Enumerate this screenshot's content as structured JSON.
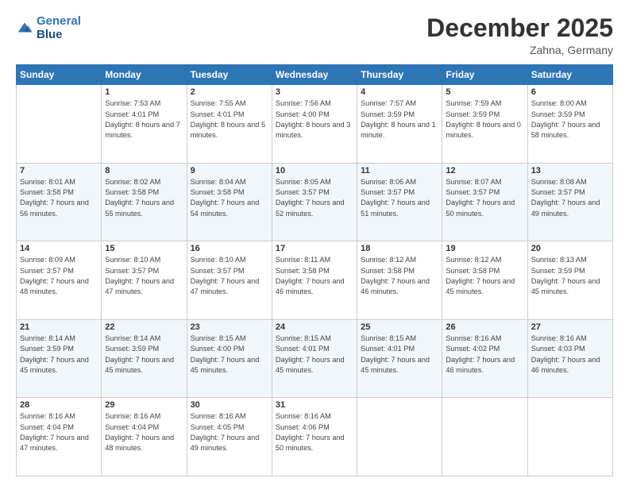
{
  "header": {
    "logo_line1": "General",
    "logo_line2": "Blue",
    "month": "December 2025",
    "location": "Zahna, Germany"
  },
  "days_of_week": [
    "Sunday",
    "Monday",
    "Tuesday",
    "Wednesday",
    "Thursday",
    "Friday",
    "Saturday"
  ],
  "weeks": [
    [
      {
        "day": "",
        "sunrise": "",
        "sunset": "",
        "daylight": ""
      },
      {
        "day": "1",
        "sunrise": "Sunrise: 7:53 AM",
        "sunset": "Sunset: 4:01 PM",
        "daylight": "Daylight: 8 hours and 7 minutes."
      },
      {
        "day": "2",
        "sunrise": "Sunrise: 7:55 AM",
        "sunset": "Sunset: 4:01 PM",
        "daylight": "Daylight: 8 hours and 5 minutes."
      },
      {
        "day": "3",
        "sunrise": "Sunrise: 7:56 AM",
        "sunset": "Sunset: 4:00 PM",
        "daylight": "Daylight: 8 hours and 3 minutes."
      },
      {
        "day": "4",
        "sunrise": "Sunrise: 7:57 AM",
        "sunset": "Sunset: 3:59 PM",
        "daylight": "Daylight: 8 hours and 1 minute."
      },
      {
        "day": "5",
        "sunrise": "Sunrise: 7:59 AM",
        "sunset": "Sunset: 3:59 PM",
        "daylight": "Daylight: 8 hours and 0 minutes."
      },
      {
        "day": "6",
        "sunrise": "Sunrise: 8:00 AM",
        "sunset": "Sunset: 3:59 PM",
        "daylight": "Daylight: 7 hours and 58 minutes."
      }
    ],
    [
      {
        "day": "7",
        "sunrise": "Sunrise: 8:01 AM",
        "sunset": "Sunset: 3:58 PM",
        "daylight": "Daylight: 7 hours and 56 minutes."
      },
      {
        "day": "8",
        "sunrise": "Sunrise: 8:02 AM",
        "sunset": "Sunset: 3:58 PM",
        "daylight": "Daylight: 7 hours and 55 minutes."
      },
      {
        "day": "9",
        "sunrise": "Sunrise: 8:04 AM",
        "sunset": "Sunset: 3:58 PM",
        "daylight": "Daylight: 7 hours and 54 minutes."
      },
      {
        "day": "10",
        "sunrise": "Sunrise: 8:05 AM",
        "sunset": "Sunset: 3:57 PM",
        "daylight": "Daylight: 7 hours and 52 minutes."
      },
      {
        "day": "11",
        "sunrise": "Sunrise: 8:06 AM",
        "sunset": "Sunset: 3:57 PM",
        "daylight": "Daylight: 7 hours and 51 minutes."
      },
      {
        "day": "12",
        "sunrise": "Sunrise: 8:07 AM",
        "sunset": "Sunset: 3:57 PM",
        "daylight": "Daylight: 7 hours and 50 minutes."
      },
      {
        "day": "13",
        "sunrise": "Sunrise: 8:08 AM",
        "sunset": "Sunset: 3:57 PM",
        "daylight": "Daylight: 7 hours and 49 minutes."
      }
    ],
    [
      {
        "day": "14",
        "sunrise": "Sunrise: 8:09 AM",
        "sunset": "Sunset: 3:57 PM",
        "daylight": "Daylight: 7 hours and 48 minutes."
      },
      {
        "day": "15",
        "sunrise": "Sunrise: 8:10 AM",
        "sunset": "Sunset: 3:57 PM",
        "daylight": "Daylight: 7 hours and 47 minutes."
      },
      {
        "day": "16",
        "sunrise": "Sunrise: 8:10 AM",
        "sunset": "Sunset: 3:57 PM",
        "daylight": "Daylight: 7 hours and 47 minutes."
      },
      {
        "day": "17",
        "sunrise": "Sunrise: 8:11 AM",
        "sunset": "Sunset: 3:58 PM",
        "daylight": "Daylight: 7 hours and 46 minutes."
      },
      {
        "day": "18",
        "sunrise": "Sunrise: 8:12 AM",
        "sunset": "Sunset: 3:58 PM",
        "daylight": "Daylight: 7 hours and 46 minutes."
      },
      {
        "day": "19",
        "sunrise": "Sunrise: 8:12 AM",
        "sunset": "Sunset: 3:58 PM",
        "daylight": "Daylight: 7 hours and 45 minutes."
      },
      {
        "day": "20",
        "sunrise": "Sunrise: 8:13 AM",
        "sunset": "Sunset: 3:59 PM",
        "daylight": "Daylight: 7 hours and 45 minutes."
      }
    ],
    [
      {
        "day": "21",
        "sunrise": "Sunrise: 8:14 AM",
        "sunset": "Sunset: 3:59 PM",
        "daylight": "Daylight: 7 hours and 45 minutes."
      },
      {
        "day": "22",
        "sunrise": "Sunrise: 8:14 AM",
        "sunset": "Sunset: 3:59 PM",
        "daylight": "Daylight: 7 hours and 45 minutes."
      },
      {
        "day": "23",
        "sunrise": "Sunrise: 8:15 AM",
        "sunset": "Sunset: 4:00 PM",
        "daylight": "Daylight: 7 hours and 45 minutes."
      },
      {
        "day": "24",
        "sunrise": "Sunrise: 8:15 AM",
        "sunset": "Sunset: 4:01 PM",
        "daylight": "Daylight: 7 hours and 45 minutes."
      },
      {
        "day": "25",
        "sunrise": "Sunrise: 8:15 AM",
        "sunset": "Sunset: 4:01 PM",
        "daylight": "Daylight: 7 hours and 45 minutes."
      },
      {
        "day": "26",
        "sunrise": "Sunrise: 8:16 AM",
        "sunset": "Sunset: 4:02 PM",
        "daylight": "Daylight: 7 hours and 46 minutes."
      },
      {
        "day": "27",
        "sunrise": "Sunrise: 8:16 AM",
        "sunset": "Sunset: 4:03 PM",
        "daylight": "Daylight: 7 hours and 46 minutes."
      }
    ],
    [
      {
        "day": "28",
        "sunrise": "Sunrise: 8:16 AM",
        "sunset": "Sunset: 4:04 PM",
        "daylight": "Daylight: 7 hours and 47 minutes."
      },
      {
        "day": "29",
        "sunrise": "Sunrise: 8:16 AM",
        "sunset": "Sunset: 4:04 PM",
        "daylight": "Daylight: 7 hours and 48 minutes."
      },
      {
        "day": "30",
        "sunrise": "Sunrise: 8:16 AM",
        "sunset": "Sunset: 4:05 PM",
        "daylight": "Daylight: 7 hours and 49 minutes."
      },
      {
        "day": "31",
        "sunrise": "Sunrise: 8:16 AM",
        "sunset": "Sunset: 4:06 PM",
        "daylight": "Daylight: 7 hours and 50 minutes."
      },
      {
        "day": "",
        "sunrise": "",
        "sunset": "",
        "daylight": ""
      },
      {
        "day": "",
        "sunrise": "",
        "sunset": "",
        "daylight": ""
      },
      {
        "day": "",
        "sunrise": "",
        "sunset": "",
        "daylight": ""
      }
    ]
  ]
}
